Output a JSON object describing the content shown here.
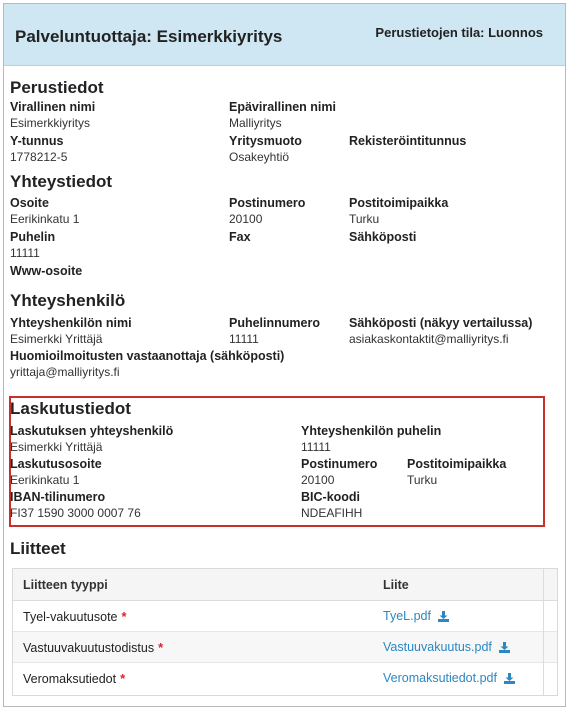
{
  "header": {
    "title": "Palveluntuottaja: Esimerkkiyritys",
    "status": "Perustietojen tila: Luonnos"
  },
  "perustiedot": {
    "heading": "Perustiedot",
    "official_name_label": "Virallinen nimi",
    "official_name_value": "Esimerkkiyritys",
    "unofficial_name_label": "Epävirallinen nimi",
    "unofficial_name_value": "Malliyritys",
    "ytunnus_label": "Y-tunnus",
    "ytunnus_value": "1778212-5",
    "company_form_label": "Yritysmuoto",
    "company_form_value": "Osakeyhtiö",
    "registry_label": "Rekisteröintitunnus"
  },
  "yhteystiedot": {
    "heading": "Yhteystiedot",
    "address_label": "Osoite",
    "address_value": "Eerikinkatu 1",
    "postcode_label": "Postinumero",
    "postcode_value": "20100",
    "city_label": "Postitoimipaikka",
    "city_value": "Turku",
    "phone_label": "Puhelin",
    "phone_value": "11111",
    "fax_label": "Fax",
    "email_label": "Sähköposti",
    "www_label": "Www-osoite"
  },
  "yhteyshenkilo": {
    "heading": "Yhteyshenkilö",
    "name_label": "Yhteyshenkilön nimi",
    "name_value": "Esimerkki Yrittäjä",
    "phone_label": "Puhelinnumero",
    "phone_value": "11111",
    "email_label": "Sähköposti (näkyy vertailussa)",
    "email_value": "asiakaskontaktit@malliyritys.fi",
    "complaint_label": "Huomioilmoitusten vastaanottaja (sähköposti)",
    "complaint_value": "yrittaja@malliyritys.fi"
  },
  "laskutustiedot": {
    "heading": "Laskutustiedot",
    "contact_label": "Laskutuksen yhteyshenkilö",
    "contact_value": "Esimerkki Yrittäjä",
    "contact_phone_label": "Yhteyshenkilön puhelin",
    "contact_phone_value": "11111",
    "address_label": "Laskutusosoite",
    "address_value": "Eerikinkatu 1",
    "postcode_label": "Postinumero",
    "postcode_value": "20100",
    "city_label": "Postitoimipaikka",
    "city_value": "Turku",
    "iban_label": "IBAN-tilinumero",
    "iban_value": "FI37 1590 3000 0007 76",
    "bic_label": "BIC-koodi",
    "bic_value": "NDEAFIHH"
  },
  "liitteet": {
    "heading": "Liitteet",
    "col_type": "Liitteen tyyppi",
    "col_file": "Liite",
    "required_mark": "*",
    "accent_link": "#2a88c2",
    "required_color": "#d9262c",
    "rows": [
      {
        "type": "Tyel-vakuutusote",
        "file": "TyeL.pdf",
        "icon": "download-icon"
      },
      {
        "type": "Vastuuvakuutustodistus",
        "file": "Vastuuvakuutus.pdf",
        "icon": "download-icon"
      },
      {
        "type": "Veromaksutiedot",
        "file": "Veromaksutiedot.pdf",
        "icon": "download-icon"
      }
    ]
  }
}
